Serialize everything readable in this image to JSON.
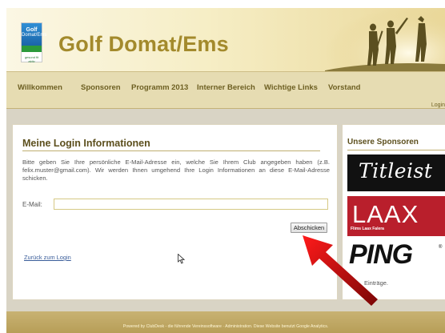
{
  "header": {
    "logo": {
      "line1": "Golf",
      "line2": "Domat/Ems",
      "tagline": "gesund fit aktiv"
    },
    "site_title": "Golf Domat/Ems"
  },
  "nav": {
    "items": [
      {
        "label": "Willkommen"
      },
      {
        "label": "Sponsoren"
      },
      {
        "label": "Programm 2013"
      },
      {
        "label": "Interner Bereich"
      },
      {
        "label": "Wichtige Links"
      },
      {
        "label": "Vorstand"
      }
    ],
    "login_label": "Login"
  },
  "main": {
    "title": "Meine Login Informationen",
    "intro": "Bitte geben Sie Ihre persönliche E-Mail-Adresse ein, welche Sie Ihrem Club angegeben haben (z.B. felix.muster@gmail.com). Wir werden Ihnen umgehend Ihre Login Informationen an diese E-Mail-Adresse schicken.",
    "email_label": "E-Mail:",
    "email_value": "",
    "submit_label": "Abschicken",
    "back_link": "Zurück zum Login"
  },
  "sidebar": {
    "title": "Unsere Sponsoren",
    "sponsors": [
      {
        "name": "Titleist",
        "color": "#111111"
      },
      {
        "name": "LAAX",
        "subtitle": "Flims Laax Falera",
        "color": "#b91f2c"
      },
      {
        "name": "PING",
        "mark": "®",
        "color": "#ffffff"
      }
    ],
    "entries_text": "Einträge."
  },
  "footer": {
    "text": "Powered by ClubDesk - die führende Vereinssoftware · Administration. Diese Website benutzt Google Analytics."
  },
  "colors": {
    "accent": "#a38a2c",
    "nav_bg": "#e6dcb2",
    "footer_bg": "#b79e57",
    "arrow": "#cc1010"
  }
}
